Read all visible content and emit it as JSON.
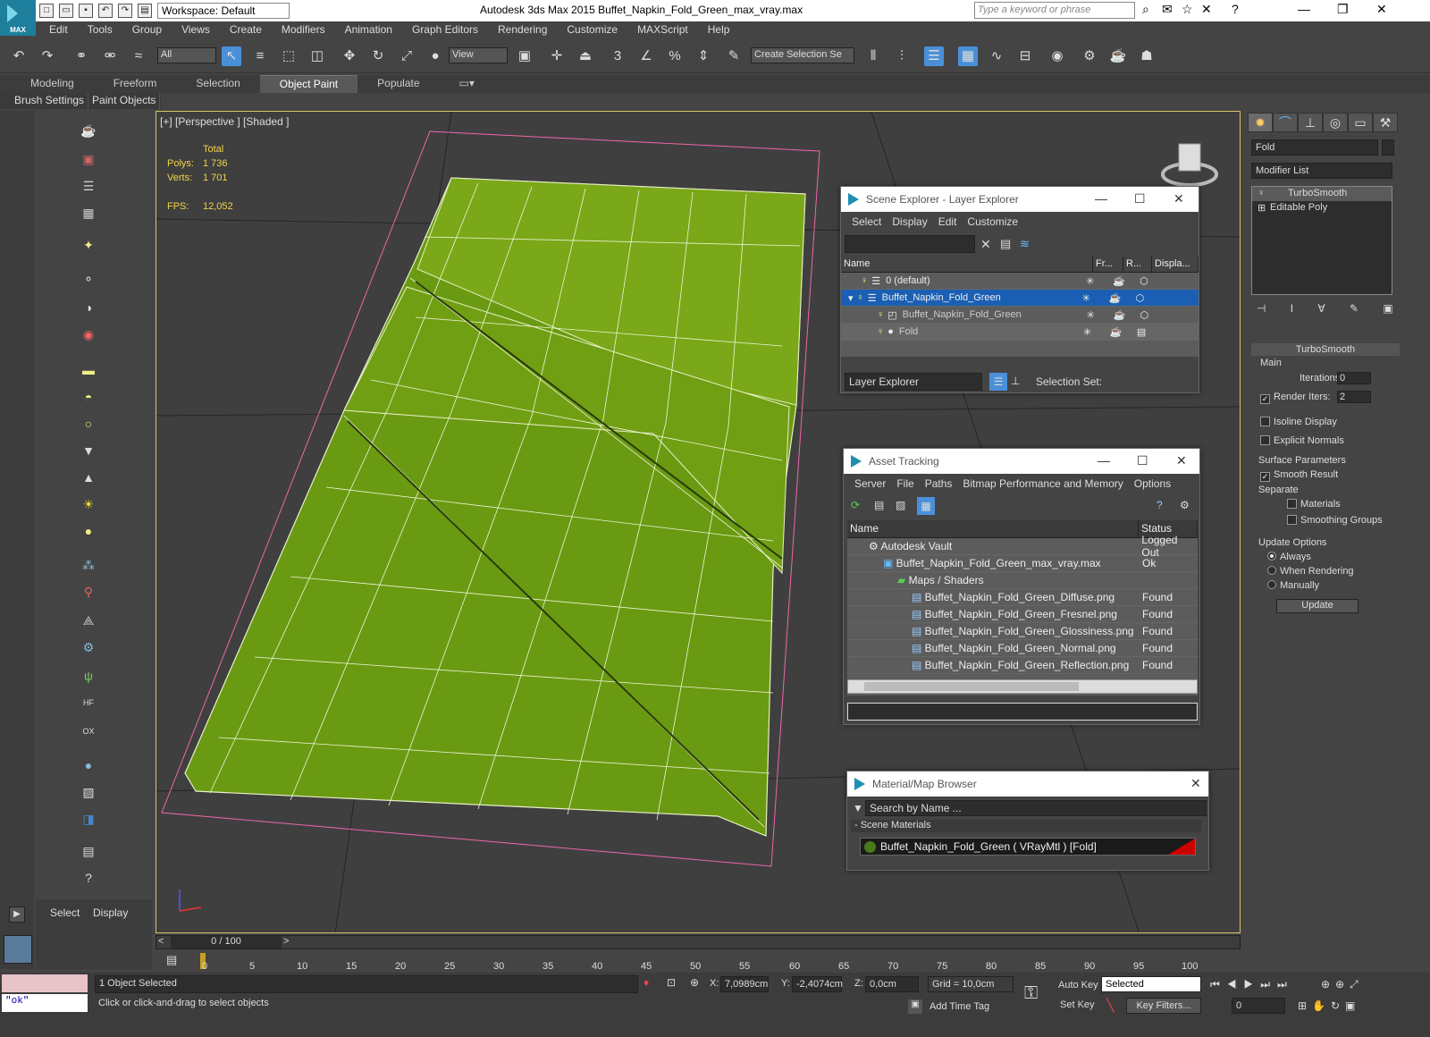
{
  "app": {
    "title": "Autodesk 3ds Max  2015     Buffet_Napkin_Fold_Green_max_vray.max",
    "logo_text": "MAX",
    "workspace": "Workspace: Default",
    "search_placeholder": "Type a keyword or phrase"
  },
  "menu": [
    "Edit",
    "Tools",
    "Group",
    "Views",
    "Create",
    "Modifiers",
    "Animation",
    "Graph Editors",
    "Rendering",
    "Customize",
    "MAXScript",
    "Help"
  ],
  "toolbar": {
    "filter": "All",
    "refcoord": "View",
    "selection_set": "Create Selection Se"
  },
  "ribbon": {
    "tabs": [
      "Modeling",
      "Freeform",
      "Selection",
      "Object Paint",
      "Populate"
    ],
    "active": "Object Paint",
    "subtabs": [
      "Brush Settings",
      "Paint Objects"
    ]
  },
  "viewport": {
    "label": "[+] [Perspective ] [Shaded ]",
    "stats": {
      "total_label": "Total",
      "polys_label": "Polys:",
      "polys": "1 736",
      "verts_label": "Verts:",
      "verts": "1 701",
      "fps_label": "FPS:",
      "fps": "12,052"
    }
  },
  "left_panel": {
    "select": "Select",
    "display": "Display"
  },
  "command_panel": {
    "object_name": "Fold",
    "modifier_list": "Modifier List",
    "stack": [
      "TurboSmooth",
      "Editable Poly"
    ],
    "rollout": "TurboSmooth",
    "main": "Main",
    "iterations_label": "Iterations:",
    "iterations": "0",
    "render_iters_label": "Render Iters:",
    "render_iters": "2",
    "isoline": "Isoline Display",
    "explicit": "Explicit Normals",
    "surface": "Surface Parameters",
    "smooth_result": "Smooth Result",
    "separate": "Separate",
    "materials": "Materials",
    "smoothing_groups": "Smoothing Groups",
    "update_options": "Update Options",
    "always": "Always",
    "when_rendering": "When Rendering",
    "manually": "Manually",
    "update_btn": "Update"
  },
  "scene_explorer": {
    "title": "Scene Explorer - Layer Explorer",
    "menu": [
      "Select",
      "Display",
      "Edit",
      "Customize"
    ],
    "columns": [
      "Name",
      "Fr...",
      "R...",
      "Displa..."
    ],
    "rows": [
      {
        "name": "0 (default)",
        "indent": 0
      },
      {
        "name": "Buffet_Napkin_Fold_Green",
        "indent": 0
      },
      {
        "name": "Buffet_Napkin_Fold_Green",
        "indent": 1
      },
      {
        "name": "Fold",
        "indent": 1
      }
    ],
    "mode": "Layer Explorer",
    "selection_set": "Selection Set:"
  },
  "asset_tracking": {
    "title": "Asset Tracking",
    "menu": [
      "Server",
      "File",
      "Paths",
      "Bitmap Performance and Memory",
      "Options"
    ],
    "columns": [
      "Name",
      "Status"
    ],
    "rows": [
      {
        "name": "Autodesk Vault",
        "status": "Logged Out",
        "indent": 1
      },
      {
        "name": "Buffet_Napkin_Fold_Green_max_vray.max",
        "status": "Ok",
        "indent": 2
      },
      {
        "name": "Maps / Shaders",
        "status": "",
        "indent": 3
      },
      {
        "name": "Buffet_Napkin_Fold_Green_Diffuse.png",
        "status": "Found",
        "indent": 4
      },
      {
        "name": "Buffet_Napkin_Fold_Green_Fresnel.png",
        "status": "Found",
        "indent": 4
      },
      {
        "name": "Buffet_Napkin_Fold_Green_Glossiness.png",
        "status": "Found",
        "indent": 4
      },
      {
        "name": "Buffet_Napkin_Fold_Green_Normal.png",
        "status": "Found",
        "indent": 4
      },
      {
        "name": "Buffet_Napkin_Fold_Green_Reflection.png",
        "status": "Found",
        "indent": 4
      }
    ]
  },
  "material_browser": {
    "title": "Material/Map Browser",
    "search": "Search by Name ...",
    "section": "- Scene Materials",
    "item": "Buffet_Napkin_Fold_Green  ( VRayMtl )  [Fold]"
  },
  "timeline": {
    "frame": "0 / 100",
    "ticks": [
      "0",
      "5",
      "10",
      "15",
      "20",
      "25",
      "30",
      "35",
      "40",
      "45",
      "50",
      "55",
      "60",
      "65",
      "70",
      "75",
      "80",
      "85",
      "90",
      "95",
      "100"
    ]
  },
  "status": {
    "maxscript": "\"ok\"",
    "selected": "1 Object Selected",
    "prompt": "Click or click-and-drag to select objects",
    "x_label": "X:",
    "x": "7,0989cm",
    "y_label": "Y:",
    "y": "-2,4074cm",
    "z_label": "Z:",
    "z": "0,0cm",
    "grid": "Grid = 10,0cm",
    "add_time_tag": "Add Time Tag",
    "auto_key": "Auto Key",
    "set_key": "Set Key",
    "selected_dropdown": "Selected",
    "key_filters": "Key Filters...",
    "frame_field": "0"
  },
  "colors": {
    "accent": "#1a5fb4",
    "viewport_border": "#d8c46a",
    "stats": "#f2d44a",
    "napkin": "#6a9a12"
  }
}
